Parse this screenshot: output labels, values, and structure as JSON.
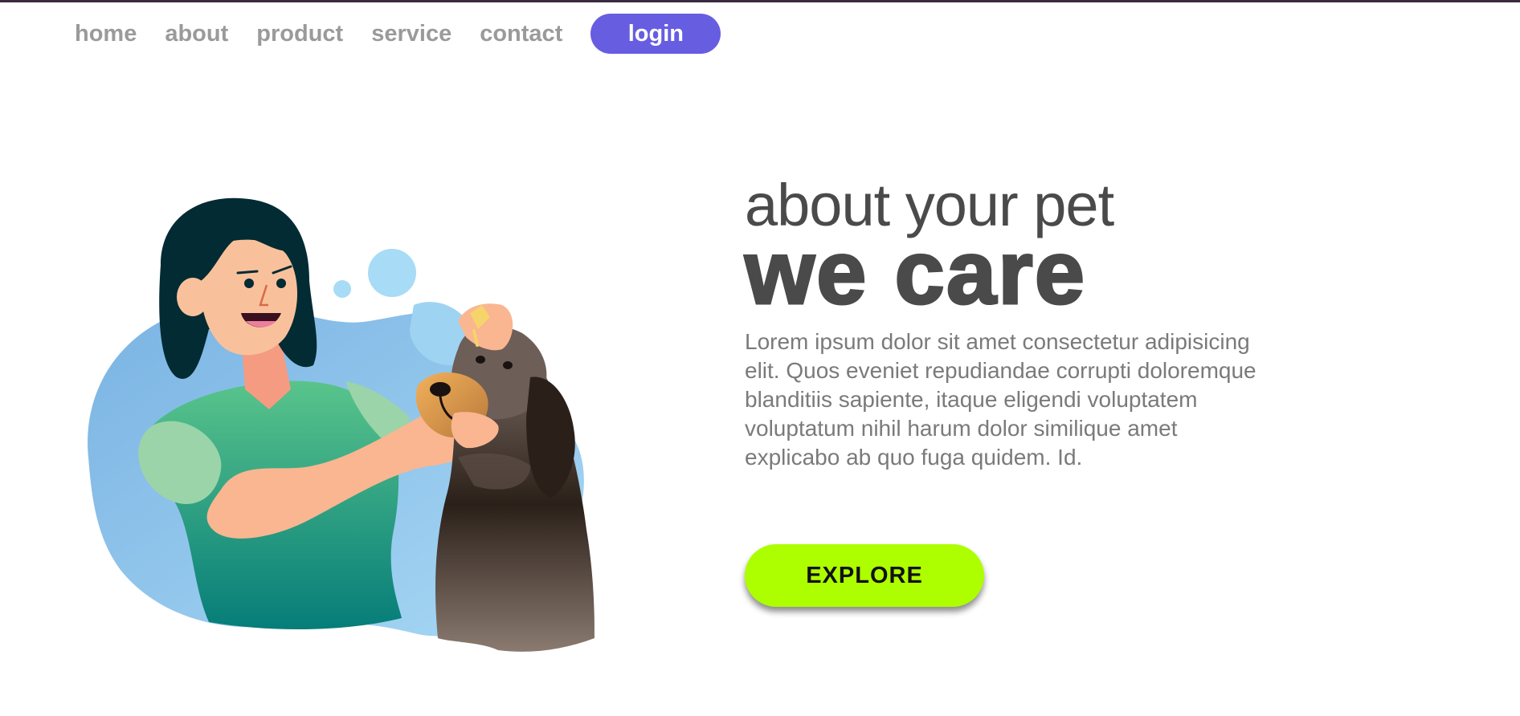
{
  "nav": {
    "links": [
      "home",
      "about",
      "product",
      "service",
      "contact"
    ],
    "login_label": "login"
  },
  "hero": {
    "subtitle": "about your pet",
    "title": "we care",
    "description": "Lorem ipsum dolor sit amet consectetur adipisicing elit. Quos eveniet repudiandae corrupti doloremque blanditiis sapiente, itaque eligendi voluptatem voluptatum nihil harum dolor similique amet explicabo ab quo fuga quidem. Id.",
    "cta_label": "EXPLORE"
  },
  "illustration": {
    "icon": "woman-caring-for-dog-illustration"
  },
  "colors": {
    "accent": "#675de1",
    "cta": "#adff00",
    "text_dark": "#4a4a4a",
    "text_muted": "#7a7a7a",
    "nav_text": "#9a9a9a",
    "blob": "#8ec8ee"
  }
}
